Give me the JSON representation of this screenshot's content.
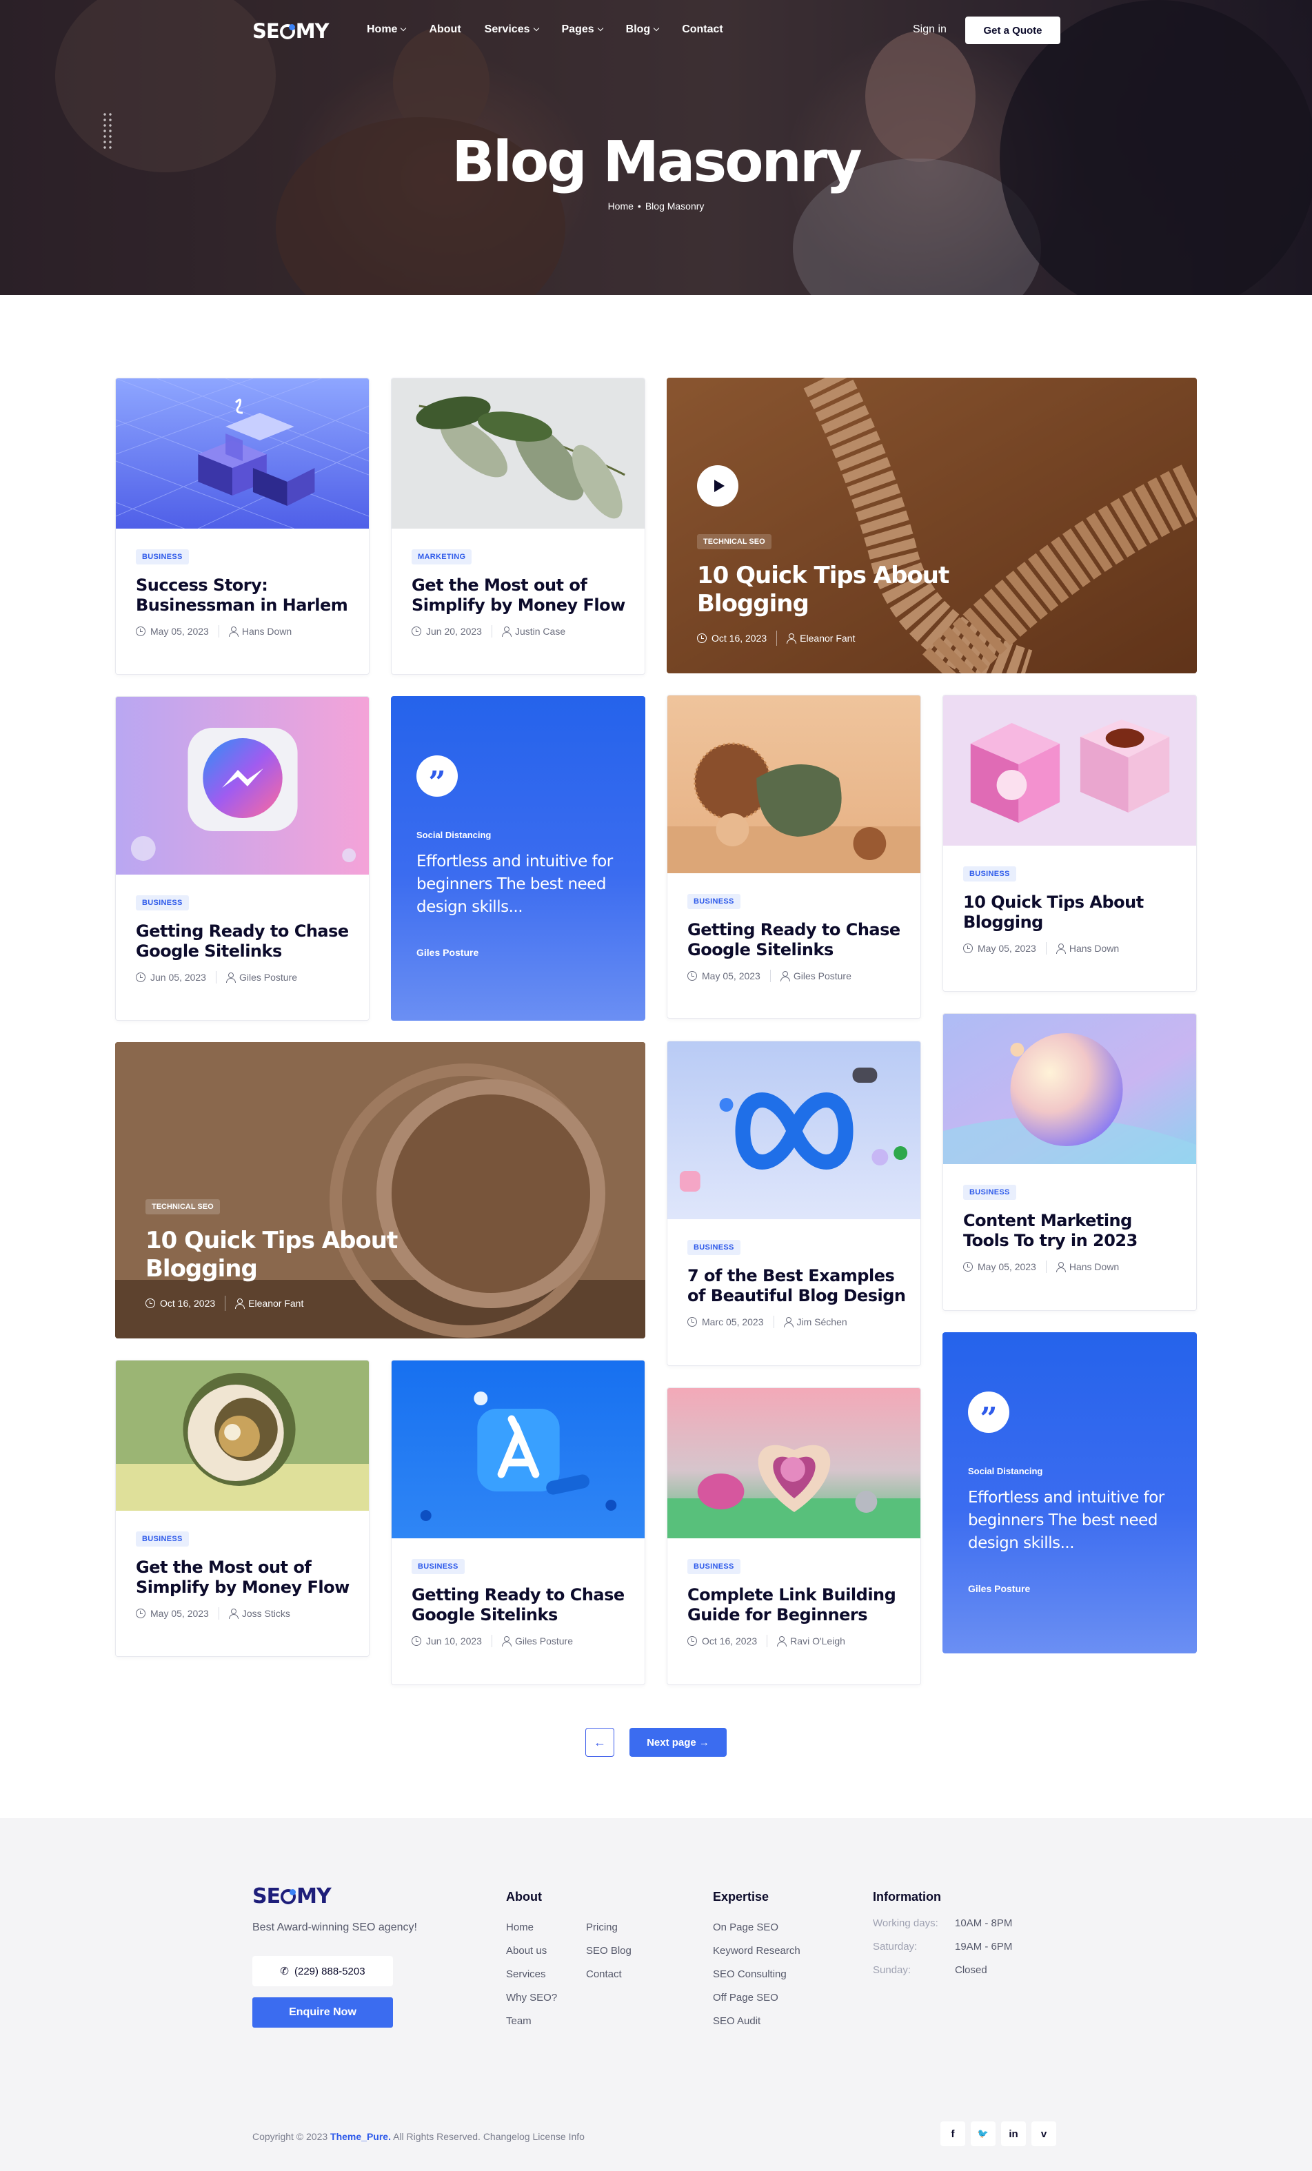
{
  "header": {
    "logo": "SEOMY",
    "nav": [
      {
        "label": "Home",
        "dropdown": true
      },
      {
        "label": "About",
        "dropdown": false
      },
      {
        "label": "Services",
        "dropdown": true
      },
      {
        "label": "Pages",
        "dropdown": true
      },
      {
        "label": "Blog",
        "dropdown": true
      },
      {
        "label": "Contact",
        "dropdown": false
      }
    ],
    "sign_in": "Sign in",
    "cta": "Get a Quote"
  },
  "hero": {
    "title": "Blog Masonry",
    "breadcrumb": {
      "home": "Home",
      "separator": "•",
      "current": "Blog Masonry"
    }
  },
  "posts": [
    {
      "tag": "BUSINESS",
      "title": "Success Story: Businessman in Harlem",
      "date": "May 05, 2023",
      "author": "Hans Down",
      "image": "blue-isometric-blocks"
    },
    {
      "tag": "MARKETING",
      "title": "Get the Most out of Simplify by Money Flow",
      "date": "Jun 20, 2023",
      "author": "Justin Case",
      "image": "green-leaves"
    },
    {
      "tag": "TECHNICAL SEO",
      "title": "10 Quick Tips About Blogging",
      "date": "Oct 16, 2023",
      "author": "Eleanor Fant",
      "image": "beaded-rope-video"
    },
    {
      "tag": "BUSINESS",
      "title": "Getting Ready to Chase Google Sitelinks",
      "date": "Jun 05, 2023",
      "author": "Giles Posture",
      "image": "messenger-app-icon"
    },
    {
      "quote_label": "Social Distancing",
      "quote": "Effortless and intuitive for beginners The best need design skills...",
      "author": "Giles Posture"
    },
    {
      "tag": "BUSINESS",
      "title": "Getting Ready to Chase Google Sitelinks",
      "date": "May 05, 2023",
      "author": "Giles Posture",
      "image": "spheres-and-bowl"
    },
    {
      "tag": "BUSINESS",
      "title": "10 Quick Tips About Blogging",
      "date": "May 05, 2023",
      "author": "Hans Down",
      "image": "pink-cubes"
    },
    {
      "tag": "TECHNICAL SEO",
      "title": "10 Quick Tips About Blogging",
      "date": "Oct 16, 2023",
      "author": "Eleanor Fant",
      "image": "wooden-ring"
    },
    {
      "tag": "BUSINESS",
      "title": "7 of the Best Examples of Beautiful Blog Design",
      "date": "Marc 05, 2023",
      "author": "Jim Séchen",
      "image": "meta-logo"
    },
    {
      "tag": "BUSINESS",
      "title": "Content Marketing Tools To try in 2023",
      "date": "May 05, 2023",
      "author": "Hans Down",
      "image": "pastel-sphere"
    },
    {
      "tag": "BUSINESS",
      "title": "Get the Most out of Simplify by Money Flow",
      "date": "May 05, 2023",
      "author": "Joss Sticks",
      "image": "sliced-sphere"
    },
    {
      "tag": "BUSINESS",
      "title": "Getting Ready to Chase Google Sitelinks",
      "date": "Jun 10, 2023",
      "author": "Giles Posture",
      "image": "app-store-icon"
    },
    {
      "tag": "BUSINESS",
      "title": "Complete Link Building Guide for Beginners",
      "date": "Oct 16, 2023",
      "author": "Ravi O'Leigh",
      "image": "heart-sculpture"
    },
    {
      "quote_label": "Social Distancing",
      "quote": "Effortless and intuitive for beginners The best need design skills...",
      "author": "Giles Posture"
    }
  ],
  "pagination": {
    "prev": "←",
    "next": "Next page →"
  },
  "footer": {
    "logo": "SEOMY",
    "tagline": "Best Award-winning SEO agency!",
    "phone": "(229) 888-5203",
    "enquire": "Enquire Now",
    "about": {
      "heading": "About",
      "col1": [
        "Home",
        "About us",
        "Services",
        "Why SEO?",
        "Team"
      ],
      "col2": [
        "Pricing",
        "SEO Blog",
        "Contact"
      ]
    },
    "expertise": {
      "heading": "Expertise",
      "links": [
        "On Page SEO",
        "Keyword Research",
        "SEO Consulting",
        "Off Page SEO",
        "SEO Audit"
      ]
    },
    "information": {
      "heading": "Information",
      "rows": [
        {
          "k": "Working days:",
          "v": "10AM - 8PM"
        },
        {
          "k": "Saturday:",
          "v": "19AM - 6PM"
        },
        {
          "k": "Sunday:",
          "v": "Closed"
        }
      ]
    },
    "copyright_prefix": "Copyright © 2023",
    "copyright_brand": "Theme_Pure.",
    "copyright_suffix": "All Rights Reserved. Changelog License Info",
    "social": [
      {
        "icon": "facebook-icon",
        "glyph": "f"
      },
      {
        "icon": "twitter-icon",
        "glyph": "🐦"
      },
      {
        "icon": "linkedin-icon",
        "glyph": "in"
      },
      {
        "icon": "vimeo-icon",
        "glyph": "v"
      }
    ]
  },
  "colors": {
    "accent": "#3b6cf0",
    "tag_bg": "#e9effd",
    "tag_text": "#2f5bea",
    "dark": "#0c0b2b"
  }
}
